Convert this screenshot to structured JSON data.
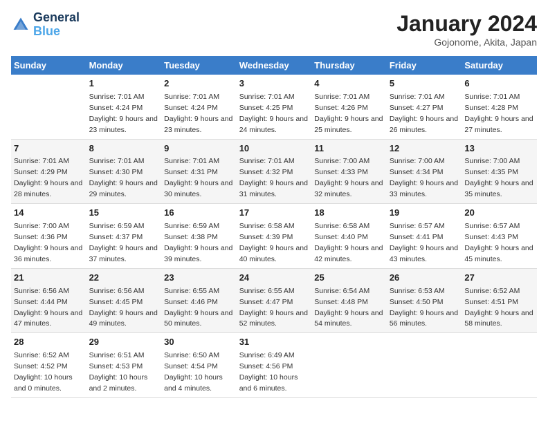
{
  "logo": {
    "line1": "General",
    "line2": "Blue"
  },
  "title": "January 2024",
  "subtitle": "Gojonome, Akita, Japan",
  "header_row": [
    "Sunday",
    "Monday",
    "Tuesday",
    "Wednesday",
    "Thursday",
    "Friday",
    "Saturday"
  ],
  "weeks": [
    [
      {
        "day": "",
        "sunrise": "",
        "sunset": "",
        "daylight": ""
      },
      {
        "day": "1",
        "sunrise": "Sunrise: 7:01 AM",
        "sunset": "Sunset: 4:24 PM",
        "daylight": "Daylight: 9 hours and 23 minutes."
      },
      {
        "day": "2",
        "sunrise": "Sunrise: 7:01 AM",
        "sunset": "Sunset: 4:24 PM",
        "daylight": "Daylight: 9 hours and 23 minutes."
      },
      {
        "day": "3",
        "sunrise": "Sunrise: 7:01 AM",
        "sunset": "Sunset: 4:25 PM",
        "daylight": "Daylight: 9 hours and 24 minutes."
      },
      {
        "day": "4",
        "sunrise": "Sunrise: 7:01 AM",
        "sunset": "Sunset: 4:26 PM",
        "daylight": "Daylight: 9 hours and 25 minutes."
      },
      {
        "day": "5",
        "sunrise": "Sunrise: 7:01 AM",
        "sunset": "Sunset: 4:27 PM",
        "daylight": "Daylight: 9 hours and 26 minutes."
      },
      {
        "day": "6",
        "sunrise": "Sunrise: 7:01 AM",
        "sunset": "Sunset: 4:28 PM",
        "daylight": "Daylight: 9 hours and 27 minutes."
      }
    ],
    [
      {
        "day": "7",
        "sunrise": "",
        "sunset": "",
        "daylight": ""
      },
      {
        "day": "8",
        "sunrise": "Sunrise: 7:01 AM",
        "sunset": "Sunset: 4:30 PM",
        "daylight": "Daylight: 9 hours and 29 minutes."
      },
      {
        "day": "9",
        "sunrise": "Sunrise: 7:01 AM",
        "sunset": "Sunset: 4:31 PM",
        "daylight": "Daylight: 9 hours and 30 minutes."
      },
      {
        "day": "10",
        "sunrise": "Sunrise: 7:01 AM",
        "sunset": "Sunset: 4:32 PM",
        "daylight": "Daylight: 9 hours and 31 minutes."
      },
      {
        "day": "11",
        "sunrise": "Sunrise: 7:00 AM",
        "sunset": "Sunset: 4:33 PM",
        "daylight": "Daylight: 9 hours and 32 minutes."
      },
      {
        "day": "12",
        "sunrise": "Sunrise: 7:00 AM",
        "sunset": "Sunset: 4:34 PM",
        "daylight": "Daylight: 9 hours and 33 minutes."
      },
      {
        "day": "13",
        "sunrise": "Sunrise: 7:00 AM",
        "sunset": "Sunset: 4:35 PM",
        "daylight": "Daylight: 9 hours and 35 minutes."
      }
    ],
    [
      {
        "day": "14",
        "sunrise": "",
        "sunset": "",
        "daylight": ""
      },
      {
        "day": "15",
        "sunrise": "Sunrise: 6:59 AM",
        "sunset": "Sunset: 4:37 PM",
        "daylight": "Daylight: 9 hours and 37 minutes."
      },
      {
        "day": "16",
        "sunrise": "Sunrise: 6:59 AM",
        "sunset": "Sunset: 4:38 PM",
        "daylight": "Daylight: 9 hours and 39 minutes."
      },
      {
        "day": "17",
        "sunrise": "Sunrise: 6:58 AM",
        "sunset": "Sunset: 4:39 PM",
        "daylight": "Daylight: 9 hours and 40 minutes."
      },
      {
        "day": "18",
        "sunrise": "Sunrise: 6:58 AM",
        "sunset": "Sunset: 4:40 PM",
        "daylight": "Daylight: 9 hours and 42 minutes."
      },
      {
        "day": "19",
        "sunrise": "Sunrise: 6:57 AM",
        "sunset": "Sunset: 4:41 PM",
        "daylight": "Daylight: 9 hours and 43 minutes."
      },
      {
        "day": "20",
        "sunrise": "Sunrise: 6:57 AM",
        "sunset": "Sunset: 4:43 PM",
        "daylight": "Daylight: 9 hours and 45 minutes."
      }
    ],
    [
      {
        "day": "21",
        "sunrise": "",
        "sunset": "",
        "daylight": ""
      },
      {
        "day": "22",
        "sunrise": "Sunrise: 6:56 AM",
        "sunset": "Sunset: 4:45 PM",
        "daylight": "Daylight: 9 hours and 49 minutes."
      },
      {
        "day": "23",
        "sunrise": "Sunrise: 6:55 AM",
        "sunset": "Sunset: 4:46 PM",
        "daylight": "Daylight: 9 hours and 50 minutes."
      },
      {
        "day": "24",
        "sunrise": "Sunrise: 6:55 AM",
        "sunset": "Sunset: 4:47 PM",
        "daylight": "Daylight: 9 hours and 52 minutes."
      },
      {
        "day": "25",
        "sunrise": "Sunrise: 6:54 AM",
        "sunset": "Sunset: 4:48 PM",
        "daylight": "Daylight: 9 hours and 54 minutes."
      },
      {
        "day": "26",
        "sunrise": "Sunrise: 6:53 AM",
        "sunset": "Sunset: 4:50 PM",
        "daylight": "Daylight: 9 hours and 56 minutes."
      },
      {
        "day": "27",
        "sunrise": "Sunrise: 6:52 AM",
        "sunset": "Sunset: 4:51 PM",
        "daylight": "Daylight: 9 hours and 58 minutes."
      }
    ],
    [
      {
        "day": "28",
        "sunrise": "",
        "sunset": "",
        "daylight": ""
      },
      {
        "day": "29",
        "sunrise": "Sunrise: 6:51 AM",
        "sunset": "Sunset: 4:53 PM",
        "daylight": "Daylight: 10 hours and 2 minutes."
      },
      {
        "day": "30",
        "sunrise": "Sunrise: 6:50 AM",
        "sunset": "Sunset: 4:54 PM",
        "daylight": "Daylight: 10 hours and 4 minutes."
      },
      {
        "day": "31",
        "sunrise": "Sunrise: 6:49 AM",
        "sunset": "Sunset: 4:56 PM",
        "daylight": "Daylight: 10 hours and 6 minutes."
      },
      {
        "day": "",
        "sunrise": "",
        "sunset": "",
        "daylight": ""
      },
      {
        "day": "",
        "sunrise": "",
        "sunset": "",
        "daylight": ""
      },
      {
        "day": "",
        "sunrise": "",
        "sunset": "",
        "daylight": ""
      }
    ]
  ],
  "week1_day7": {
    "sunrise": "Sunrise: 7:01 AM",
    "sunset": "Sunset: 4:29 PM",
    "daylight": "Daylight: 9 hours and 28 minutes."
  },
  "week2_day14": {
    "sunrise": "Sunrise: 7:00 AM",
    "sunset": "Sunset: 4:36 PM",
    "daylight": "Daylight: 9 hours and 36 minutes."
  },
  "week3_day21": {
    "sunrise": "Sunrise: 6:56 AM",
    "sunset": "Sunset: 4:44 PM",
    "daylight": "Daylight: 9 hours and 47 minutes."
  },
  "week4_day28": {
    "sunrise": "Sunrise: 6:52 AM",
    "sunset": "Sunset: 4:52 PM",
    "daylight": "Daylight: 10 hours and 0 minutes."
  }
}
